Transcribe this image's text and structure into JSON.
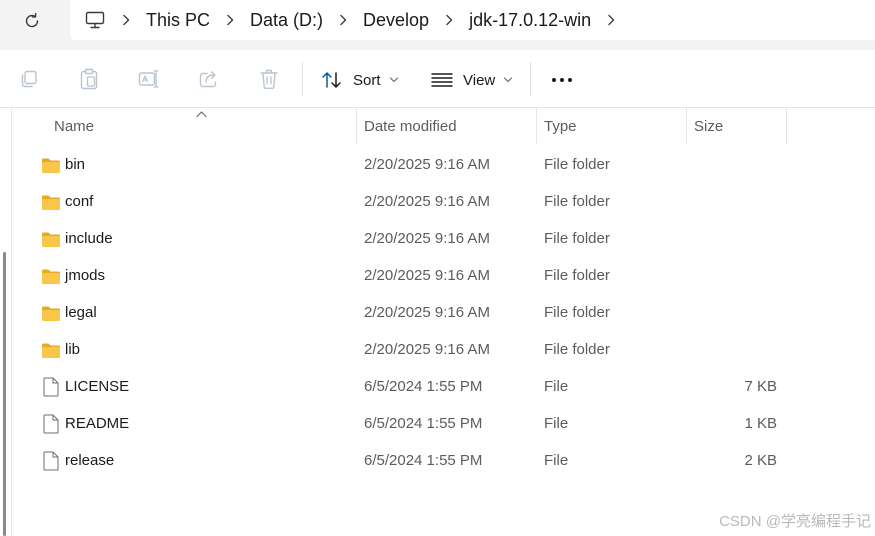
{
  "address_bar": {
    "breadcrumbs": [
      "This PC",
      "Data (D:)",
      "Develop",
      "jdk-17.0.12-win"
    ]
  },
  "command_bar": {
    "sort_label": "Sort",
    "view_label": "View",
    "more_label": "•••"
  },
  "columns": {
    "name": "Name",
    "date": "Date modified",
    "type": "Type",
    "size": "Size"
  },
  "files": [
    {
      "name": "bin",
      "date": "2/20/2025 9:16 AM",
      "type": "File folder",
      "size": "",
      "icon": "folder-icon"
    },
    {
      "name": "conf",
      "date": "2/20/2025 9:16 AM",
      "type": "File folder",
      "size": "",
      "icon": "folder-icon"
    },
    {
      "name": "include",
      "date": "2/20/2025 9:16 AM",
      "type": "File folder",
      "size": "",
      "icon": "folder-icon"
    },
    {
      "name": "jmods",
      "date": "2/20/2025 9:16 AM",
      "type": "File folder",
      "size": "",
      "icon": "folder-icon"
    },
    {
      "name": "legal",
      "date": "2/20/2025 9:16 AM",
      "type": "File folder",
      "size": "",
      "icon": "folder-icon"
    },
    {
      "name": "lib",
      "date": "2/20/2025 9:16 AM",
      "type": "File folder",
      "size": "",
      "icon": "folder-icon"
    },
    {
      "name": "LICENSE",
      "date": "6/5/2024 1:55 PM",
      "type": "File",
      "size": "7 KB",
      "icon": "file-icon"
    },
    {
      "name": "README",
      "date": "6/5/2024 1:55 PM",
      "type": "File",
      "size": "1 KB",
      "icon": "file-icon"
    },
    {
      "name": "release",
      "date": "6/5/2024 1:55 PM",
      "type": "File",
      "size": "2 KB",
      "icon": "file-icon"
    }
  ],
  "watermark": "CSDN @学亮编程手记",
  "colors": {
    "folder": "#f8c74a",
    "folder_dark": "#e7a924",
    "text_primary": "#1b1b1b",
    "text_secondary": "#5c5c5c",
    "disabled_icon": "#b8c4d0",
    "accent_icon": "#005a9e"
  }
}
